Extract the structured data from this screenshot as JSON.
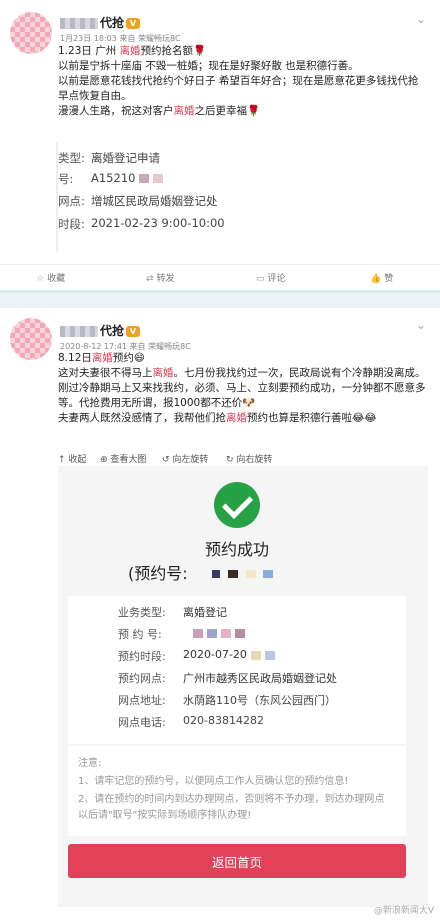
{
  "post1": {
    "username": "代抢",
    "timestamp": "1月23日 18:03 来自 荣耀畅玩8C",
    "lines": {
      "l1_pre": "1.23日 广州",
      "l1_hl": "离婚",
      "l1_post": "预约抢名额",
      "l2": "以前是宁拆十座庙 不毁一桩婚；现在是好聚好散 也是积德行善。",
      "l3": "以前是愿意花钱找代抢约个好日子 希望百年好合；现在是愿意花更多钱找代抢 早点恢复自由。",
      "l4_pre": "漫漫人生路，祝这对客户",
      "l4_hl": "离婚",
      "l4_post": "之后更幸福"
    },
    "card": {
      "type_label": "类型:",
      "type_value": "离婚登记申请",
      "no_label": "号:",
      "no_value": "A15210",
      "site_label": "网点:",
      "site_value": "增城区民政局婚姻登记处",
      "time_label": "时段:",
      "time_value": "2021-02-23 9:00-10:00"
    },
    "actions": {
      "fav": "收藏",
      "repost": "转发",
      "comment": "评论",
      "like": "赞"
    }
  },
  "post2": {
    "username": "代抢",
    "timestamp": "2020-8-12 17:41 来自 荣耀畅玩8C",
    "lines": {
      "l1_pre": "8.12日",
      "l1_hl": "离婚",
      "l1_post": "预约",
      "l2_pre": "这对夫妻很不得马上",
      "l2_hl": "离婚",
      "l2_post": "。七月份我找约过一次，民政局说有个冷静期没离成。",
      "l3": "刚过冷静期马上又来找我约，必须、马上、立刻要预约成功，一分钟都不愿意多",
      "l4": "等。代抢费用无所谓，报1000都不还价",
      "l5_pre": "夫妻两人既然没感情了，我帮他们抢",
      "l5_hl": "离婚",
      "l5_post": "预约也算是积德行善啦"
    },
    "toolbar": {
      "collapse": "收起",
      "view_large": "查看大图",
      "rotate_left": "向左旋转",
      "rotate_right": "向右旋转"
    },
    "screenshot": {
      "success_title": "预约成功",
      "resv_label": "(预约号:",
      "rows": {
        "biz_label": "业务类型:",
        "biz_value": "离婚登记",
        "no_label": "预 约 号:",
        "time_label": "预约时段:",
        "time_value": "2020-07-20",
        "site_label": "预约网点:",
        "site_value": "广州市越秀区民政局婚姻登记处",
        "addr_label": "网点地址:",
        "addr_value": "水荫路110号（东风公园西门）",
        "tel_label": "网点电话:",
        "tel_value": "020-83814282"
      },
      "notes": {
        "title": "注意:",
        "n1": "1、请牢记您的预约号，以便网点工作人员确认您的预约信息!",
        "n2": "2、请在预约的时间内到达办理网点，否则将不予办理，到达办理网点",
        "n3": "以后请\"取号\"按实际到场顺序排队办理!"
      },
      "back_button": "返回首页"
    },
    "watermark": "@新浪新闻大V"
  },
  "colors": {
    "highlight": "#e0364f",
    "button": "#e3405a",
    "success": "#25a244"
  }
}
